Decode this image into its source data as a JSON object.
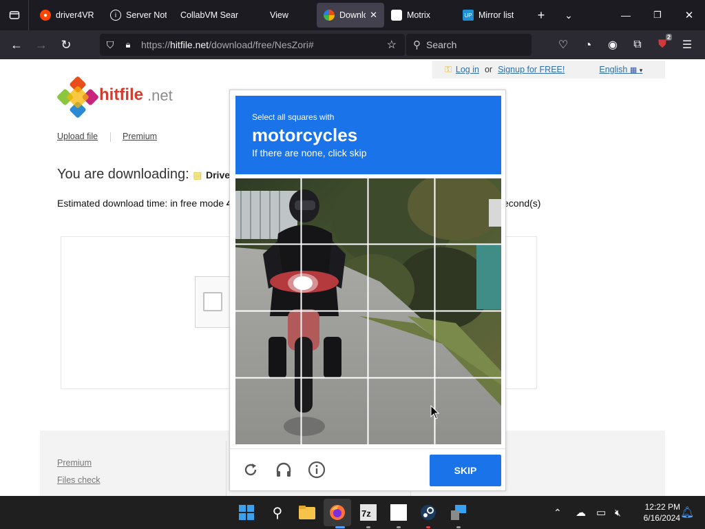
{
  "browser": {
    "tabs": [
      {
        "title": "driver4VR",
        "favicon": "reddit-icon",
        "color": "#ff4500"
      },
      {
        "title": "Server Not",
        "favicon": "info-icon",
        "color": "#fbfbfe"
      },
      {
        "title": "CollabVM Sear",
        "favicon": "",
        "color": ""
      },
      {
        "title": "View",
        "favicon": "",
        "color": ""
      },
      {
        "title": "Downlo",
        "favicon": "hitfile-icon",
        "color": "#e84e1b",
        "active": true
      },
      {
        "title": "Motrix",
        "favicon": "motrix-icon",
        "color": "#ffffff"
      },
      {
        "title": "Mirror list",
        "favicon": "up-icon",
        "color": "#1f8fd6"
      }
    ],
    "url": {
      "scheme": "https://",
      "host": "hitfile.net",
      "path": "/download/free/NesZori#"
    },
    "search_placeholder": "Search",
    "extension_badge": "2"
  },
  "page": {
    "login_link": "Log in",
    "or_text": "or",
    "signup_link": "Signup for FREE!",
    "language": "English",
    "logo_text_main": "hitfile",
    "logo_text_tld": ".net",
    "nav": [
      "Upload file",
      "Premium"
    ],
    "downloading_label": "You are downloading:",
    "downloading_file": "Drive",
    "est_time_left": "Estimated download time: in free mode",
    "est_time_value": "4",
    "est_time_right": "econd(s)",
    "footer_links": [
      "Premium",
      "Files check"
    ]
  },
  "captcha": {
    "instruction": "Select all squares with",
    "target": "motorcycles",
    "hint": "If there are none, click skip",
    "skip_label": "SKIP"
  },
  "taskbar": {
    "time": "12:22 PM",
    "date": "6/16/2024"
  },
  "colors": {
    "captcha_blue": "#1a73e8",
    "tabbar": "#1c1b22",
    "navbar": "#2b2a33"
  }
}
